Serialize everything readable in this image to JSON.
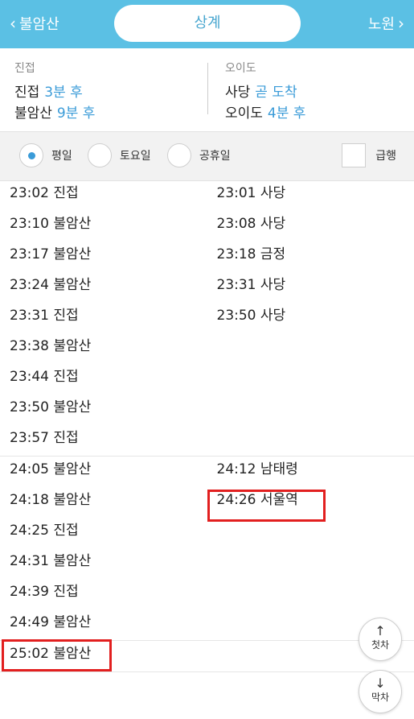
{
  "header": {
    "prev_station": "불암산",
    "current_station": "상계",
    "next_station": "노원"
  },
  "arrivals": {
    "left": {
      "direction": "진접",
      "rows": [
        {
          "dest": "진접",
          "time": "3분 후"
        },
        {
          "dest": "불암산",
          "time": "9분 후"
        }
      ]
    },
    "right": {
      "direction": "오이도",
      "rows": [
        {
          "dest": "사당",
          "time": "곧 도착"
        },
        {
          "dest": "오이도",
          "time": "4분 후"
        }
      ]
    }
  },
  "filter": {
    "weekday": "평일",
    "saturday": "토요일",
    "holiday": "공휴일",
    "express": "급행",
    "selected": "평일"
  },
  "timetable": {
    "hour23": {
      "left": [
        "23:02 진접",
        "23:10 불암산",
        "23:17 불암산",
        "23:24 불암산",
        "23:31 진접",
        "23:38 불암산",
        "23:44 진접",
        "23:50 불암산",
        "23:57 진접"
      ],
      "right": [
        "23:01 사당",
        "23:08 사당",
        "23:18 금정",
        "23:31 사당",
        "23:50 사당"
      ]
    },
    "hour24": {
      "left": [
        "24:05 불암산",
        "24:18 불암산",
        "24:25 진접",
        "24:31 불암산",
        "24:39 진접",
        "24:49 불암산"
      ],
      "right": [
        "24:12 남태령",
        "24:26 서울역"
      ]
    },
    "hour25": {
      "left": [
        "25:02 불암산"
      ],
      "right": []
    }
  },
  "buttons": {
    "first_train": "첫차",
    "last_train": "막차"
  },
  "colors": {
    "header_bg": "#5bc0e4",
    "accent": "#3a9bd8",
    "highlight": "#e21f1f"
  }
}
